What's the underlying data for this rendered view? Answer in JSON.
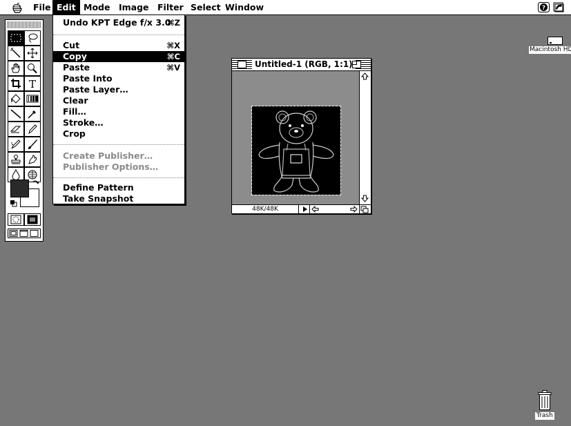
{
  "menubar": {
    "items": [
      {
        "label": "File"
      },
      {
        "label": "Edit"
      },
      {
        "label": "Mode"
      },
      {
        "label": "Image"
      },
      {
        "label": "Filter"
      },
      {
        "label": "Select"
      },
      {
        "label": "Window"
      }
    ],
    "active_menu": "Edit"
  },
  "edit_menu": {
    "items": [
      {
        "label": "Undo KPT Edge f/x 3.0",
        "shortcut": "⌘Z",
        "state": "enabled"
      },
      {
        "label": "Cut",
        "shortcut": "⌘X",
        "state": "enabled"
      },
      {
        "label": "Copy",
        "shortcut": "⌘C",
        "state": "highlighted"
      },
      {
        "label": "Paste",
        "shortcut": "⌘V",
        "state": "enabled"
      },
      {
        "label": "Paste Into",
        "shortcut": "",
        "state": "enabled"
      },
      {
        "label": "Paste Layer…",
        "shortcut": "",
        "state": "enabled"
      },
      {
        "label": "Clear",
        "shortcut": "",
        "state": "enabled"
      },
      {
        "label": "Fill…",
        "shortcut": "",
        "state": "enabled"
      },
      {
        "label": "Stroke…",
        "shortcut": "",
        "state": "enabled"
      },
      {
        "label": "Crop",
        "shortcut": "",
        "state": "enabled"
      },
      {
        "label": "Create Publisher…",
        "shortcut": "",
        "state": "disabled"
      },
      {
        "label": "Publisher Options…",
        "shortcut": "",
        "state": "disabled"
      },
      {
        "label": "Define Pattern",
        "shortcut": "",
        "state": "enabled"
      },
      {
        "label": "Take Snapshot",
        "shortcut": "",
        "state": "enabled"
      }
    ]
  },
  "document_window": {
    "title": "Untitled-1  (RGB, 1:1)",
    "size_indicator": "48K/48K"
  },
  "tools": [
    "marquee-tool",
    "lasso-tool",
    "magic-wand-tool",
    "move-tool",
    "hand-tool",
    "zoom-tool",
    "crop-tool",
    "type-tool",
    "paint-bucket-tool",
    "gradient-tool",
    "line-tool",
    "eyedropper-tool",
    "eraser-tool",
    "pencil-tool",
    "airbrush-tool",
    "paintbrush-tool",
    "rubber-stamp-tool",
    "smudge-tool",
    "blur-tool",
    "dodge-burn-tool"
  ],
  "colors": {
    "desktop": "#777777",
    "foreground_swatch": "#2a2a2a",
    "background_swatch": "#ffffff"
  },
  "desktop": {
    "disk_label": "Macintosh HD",
    "trash_label": "Trash"
  }
}
